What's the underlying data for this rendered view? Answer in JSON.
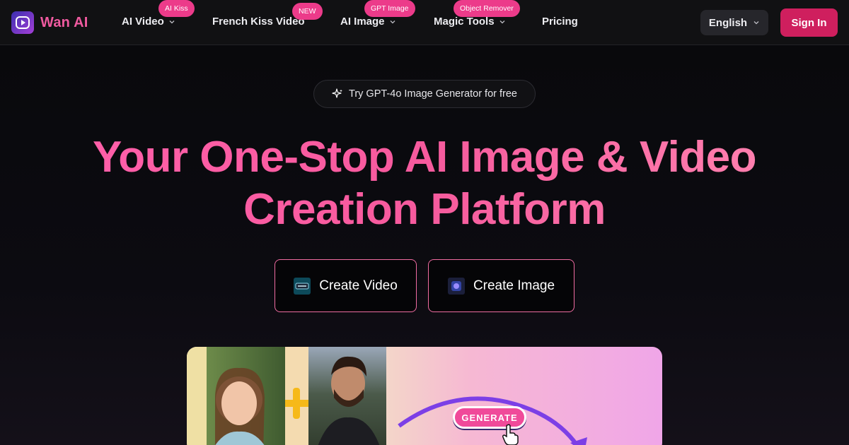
{
  "brand": {
    "name": "Wan AI"
  },
  "nav": {
    "items": [
      {
        "label": "AI Video",
        "badge": "AI Kiss",
        "dropdown": true
      },
      {
        "label": "French Kiss Video",
        "badge": "NEW",
        "dropdown": false
      },
      {
        "label": "AI Image",
        "badge": "GPT Image",
        "dropdown": true
      },
      {
        "label": "Magic Tools",
        "badge": "Object Remover",
        "dropdown": true
      },
      {
        "label": "Pricing",
        "badge": "",
        "dropdown": false
      }
    ],
    "language": "English",
    "sign_in": "Sign In"
  },
  "hero": {
    "promo": "Try GPT-4o Image Generator for free",
    "title_line1": "Your One-Stop AI Image & Video",
    "title_line2": "Creation Platform",
    "cta_video": "Create Video",
    "cta_image": "Create Image"
  },
  "preview": {
    "button_label": "GENERATE"
  },
  "colors": {
    "accent": "#f05aa0",
    "sign_in_bg": "#cf1f5e",
    "badge_bg": "#ec3b8a",
    "nav_bg": "#111113",
    "page_bg": "#08080b"
  },
  "icons": [
    "logo-play-icon",
    "chevron-down-icon",
    "sparkle-icon",
    "video-thumb-icon",
    "image-thumb-icon",
    "pointer-hand-icon"
  ]
}
